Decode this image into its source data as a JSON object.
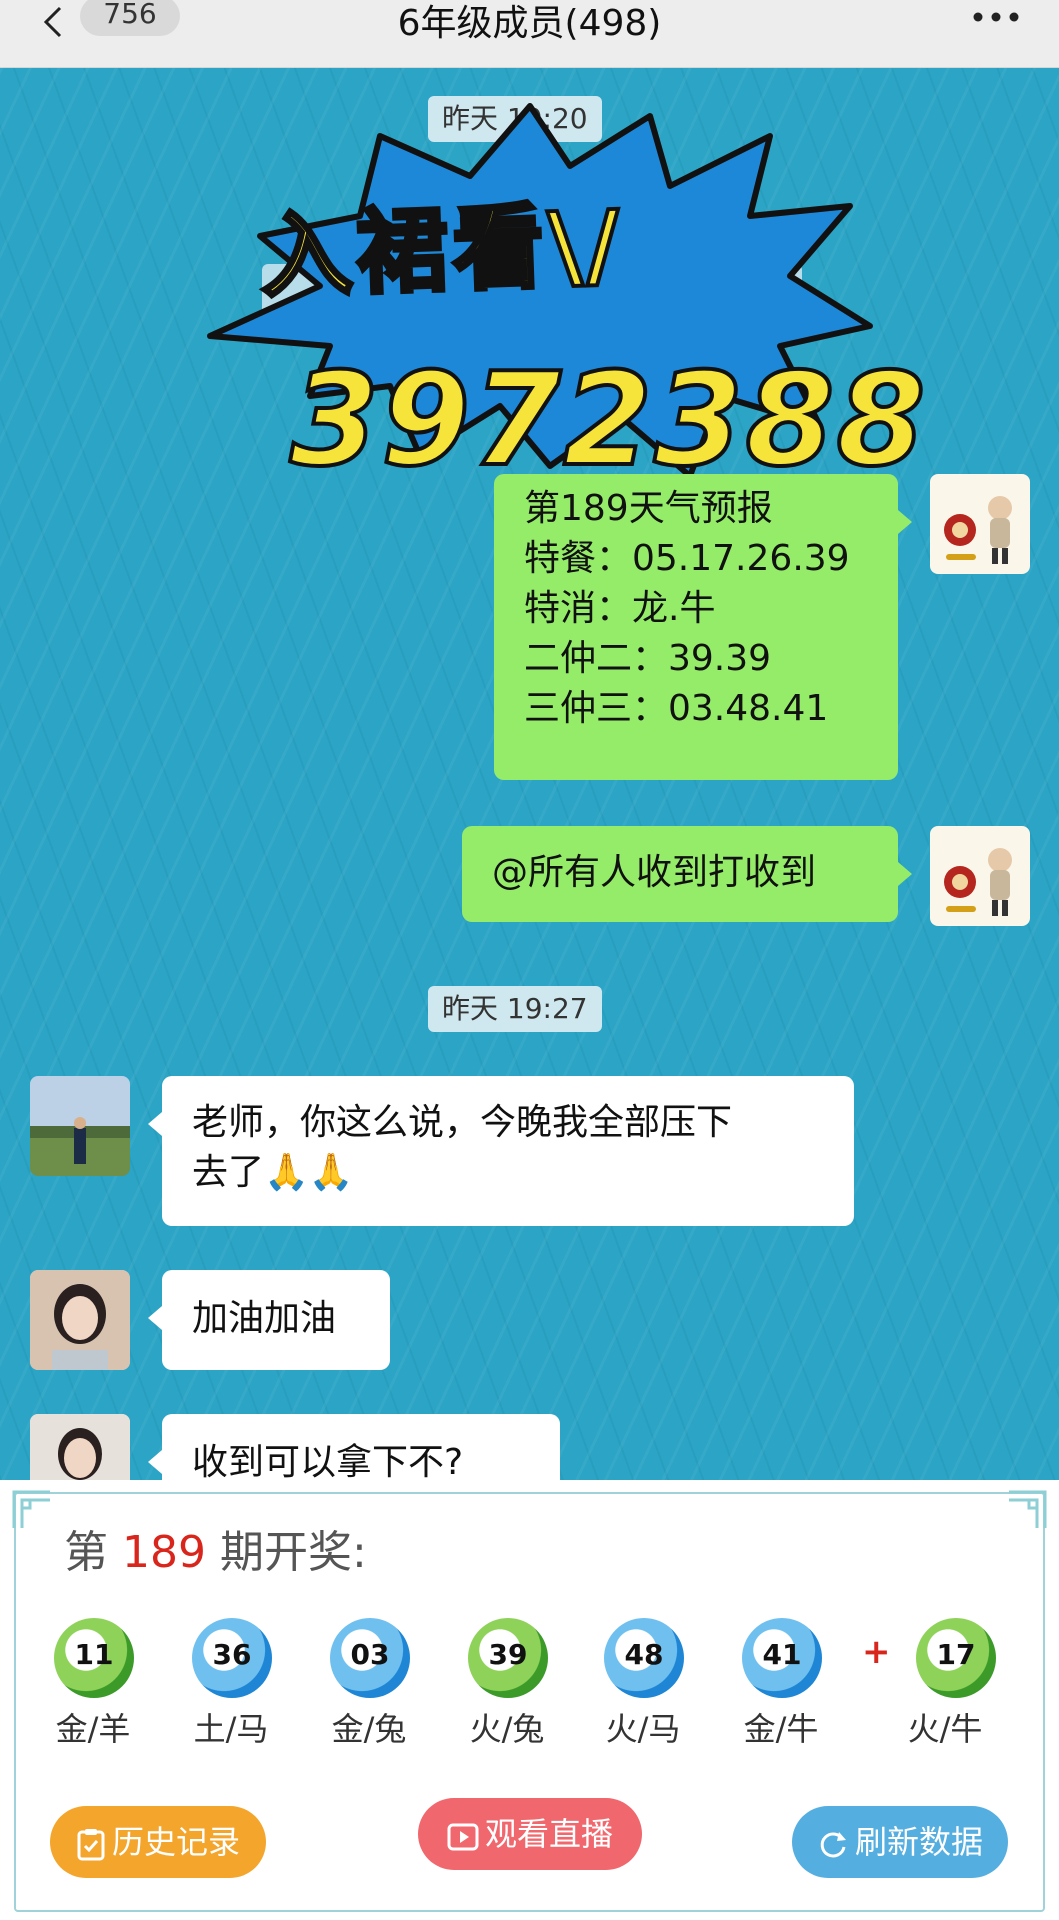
{
  "header": {
    "back_count": "756",
    "title": "6年级成员(498)"
  },
  "chat": {
    "time_1": "昨天 19:20",
    "promo": {
      "line1": "入裙看\\/",
      "line2": "3972388"
    },
    "forecast": {
      "lines": [
        "第189天气预报",
        "特餐：05.17.26.39",
        "特消：龙.牛",
        "二仲二：39.39",
        "三仲三：03.48.41"
      ]
    },
    "mention": "@所有人收到打收到",
    "time_2": "昨天 19:27",
    "msg_1": {
      "line1": "老师，你这么说，今晚我全部压下",
      "line2": "去了🙏🙏"
    },
    "msg_2": "加油加油",
    "msg_3": "收到可以拿下不?"
  },
  "draw": {
    "prefix": "第",
    "period": "189",
    "suffix": "期开奖:",
    "balls": [
      {
        "number": "11",
        "label": "金/羊",
        "color": "green"
      },
      {
        "number": "36",
        "label": "土/马",
        "color": "blue"
      },
      {
        "number": "03",
        "label": "金/兔",
        "color": "blue"
      },
      {
        "number": "39",
        "label": "火/兔",
        "color": "green"
      },
      {
        "number": "48",
        "label": "火/马",
        "color": "blue"
      },
      {
        "number": "41",
        "label": "金/牛",
        "color": "blue"
      }
    ],
    "plus": "+",
    "special": {
      "number": "17",
      "label": "火/牛",
      "color": "green"
    },
    "buttons": {
      "history": "历史记录",
      "live": "观看直播",
      "refresh": "刷新数据"
    }
  },
  "colors": {
    "chat_bg": "#2ba4c5",
    "bubble_green": "#95ec69",
    "promo_yellow": "#f7e43a",
    "promo_blue": "#1e88d8",
    "accent_red": "#d9261c"
  }
}
